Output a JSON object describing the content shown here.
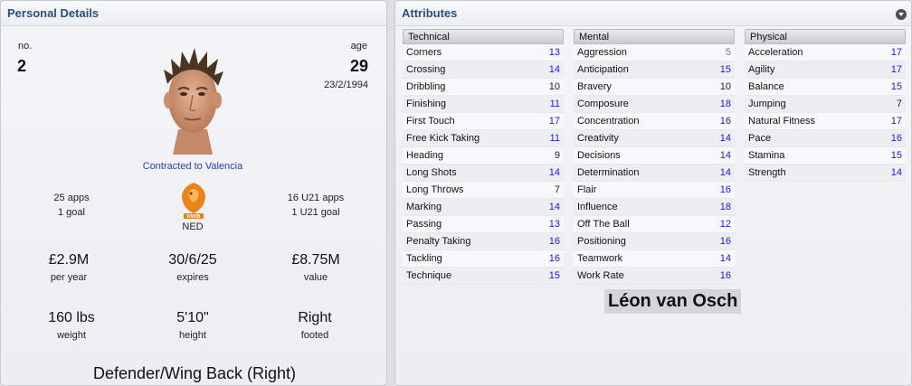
{
  "personal": {
    "header": "Personal Details",
    "no_label": "no.",
    "no_value": "2",
    "age_label": "age",
    "age_value": "29",
    "dob": "23/2/1994",
    "contract": "Contracted to Valencia",
    "apps": "25 apps",
    "goals": "1 goal",
    "nation": "NED",
    "u21_apps": "16 U21 apps",
    "u21_goals": "1 U21 goal",
    "wage": "£2.9M",
    "wage_label": "per year",
    "expires": "30/6/25",
    "expires_label": "expires",
    "value": "£8.75M",
    "value_label": "value",
    "weight": "160 lbs",
    "weight_label": "weight",
    "height": "5'10\"",
    "height_label": "height",
    "foot": "Right",
    "foot_label": "footed",
    "position": "Defender/Wing Back (Right)",
    "badge_text": "KNVB"
  },
  "attributes": {
    "header": "Attributes",
    "columns": [
      {
        "title": "Technical",
        "rows": [
          {
            "name": "Corners",
            "value": "13"
          },
          {
            "name": "Crossing",
            "value": "14"
          },
          {
            "name": "Dribbling",
            "value": "10"
          },
          {
            "name": "Finishing",
            "value": "11"
          },
          {
            "name": "First Touch",
            "value": "17"
          },
          {
            "name": "Free Kick Taking",
            "value": "11"
          },
          {
            "name": "Heading",
            "value": "9"
          },
          {
            "name": "Long Shots",
            "value": "14"
          },
          {
            "name": "Long Throws",
            "value": "7"
          },
          {
            "name": "Marking",
            "value": "14"
          },
          {
            "name": "Passing",
            "value": "13"
          },
          {
            "name": "Penalty Taking",
            "value": "16"
          },
          {
            "name": "Tackling",
            "value": "16"
          },
          {
            "name": "Technique",
            "value": "15"
          }
        ]
      },
      {
        "title": "Mental",
        "rows": [
          {
            "name": "Aggression",
            "value": "5"
          },
          {
            "name": "Anticipation",
            "value": "15"
          },
          {
            "name": "Bravery",
            "value": "10"
          },
          {
            "name": "Composure",
            "value": "18"
          },
          {
            "name": "Concentration",
            "value": "16"
          },
          {
            "name": "Creativity",
            "value": "14"
          },
          {
            "name": "Decisions",
            "value": "14"
          },
          {
            "name": "Determination",
            "value": "14"
          },
          {
            "name": "Flair",
            "value": "16"
          },
          {
            "name": "Influence",
            "value": "18"
          },
          {
            "name": "Off The Ball",
            "value": "12"
          },
          {
            "name": "Positioning",
            "value": "16"
          },
          {
            "name": "Teamwork",
            "value": "14"
          },
          {
            "name": "Work Rate",
            "value": "16"
          }
        ]
      },
      {
        "title": "Physical",
        "rows": [
          {
            "name": "Acceleration",
            "value": "17"
          },
          {
            "name": "Agility",
            "value": "17"
          },
          {
            "name": "Balance",
            "value": "15"
          },
          {
            "name": "Jumping",
            "value": "7"
          },
          {
            "name": "Natural Fitness",
            "value": "17"
          },
          {
            "name": "Pace",
            "value": "16"
          },
          {
            "name": "Stamina",
            "value": "15"
          },
          {
            "name": "Strength",
            "value": "14"
          }
        ]
      }
    ]
  },
  "player_name": "Léon van Osch",
  "colors": {
    "header_text": "#2c4f7a",
    "high_value": "#1a1adf",
    "contract_link": "#2a3fa8"
  }
}
